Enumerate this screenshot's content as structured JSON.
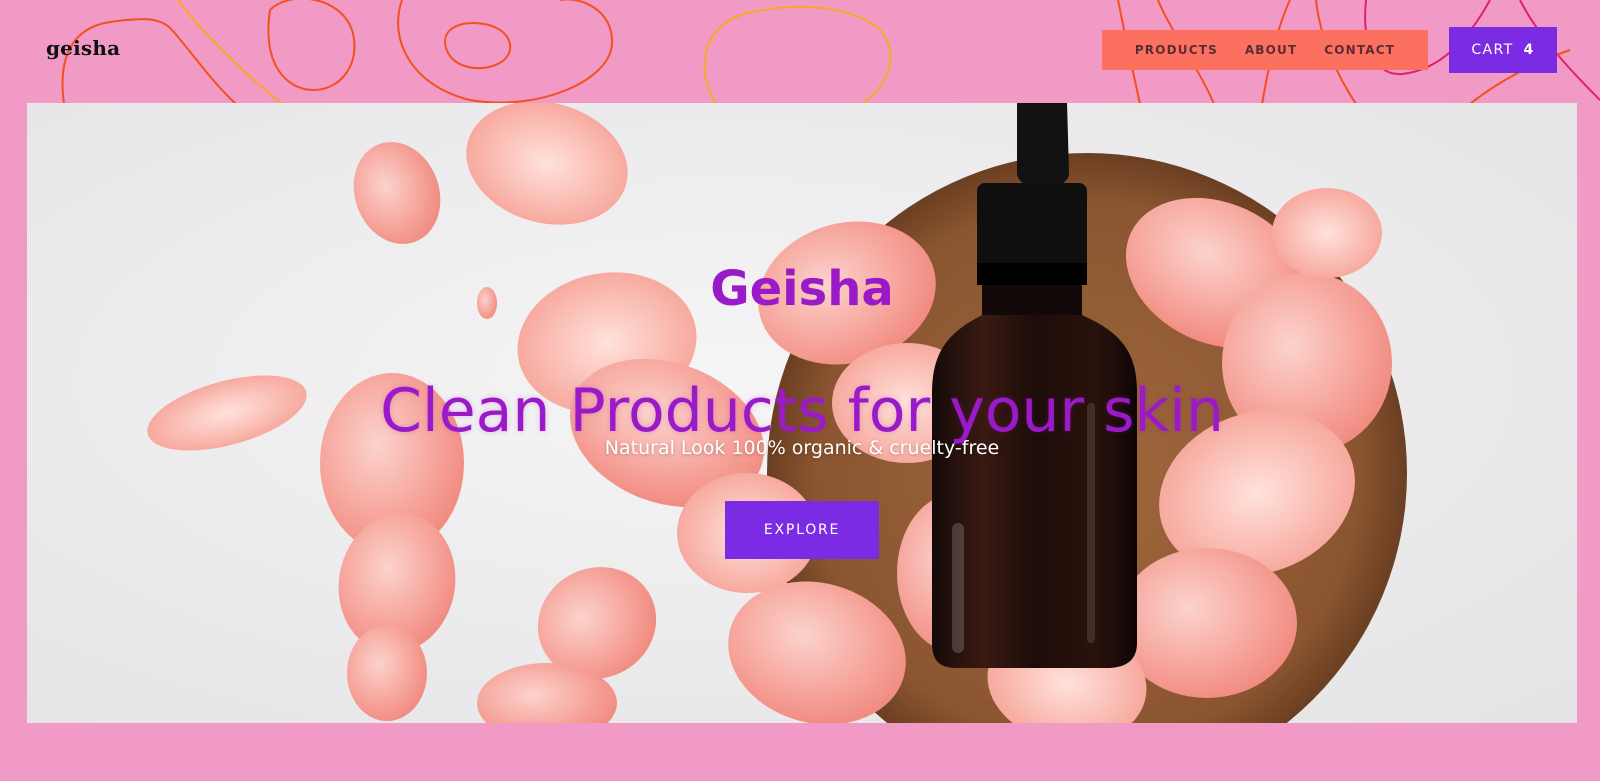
{
  "header": {
    "logo": "geisha",
    "nav": [
      {
        "label": "PRODUCTS"
      },
      {
        "label": "ABOUT"
      },
      {
        "label": "CONTACT"
      }
    ],
    "cart": {
      "label": "CART",
      "count": "4"
    }
  },
  "hero": {
    "brand": "Geisha",
    "heading": "Clean Products for your skin",
    "subheading": "Natural Look 100% organic & cruelty-free",
    "button_label": "EXPLORE"
  },
  "colors": {
    "page_background": "#f09ac5",
    "nav_background": "#fb705f",
    "accent_purple": "#7b2be3",
    "heading_purple": "#9b1ac8",
    "doodle_orange": "#f4501e",
    "doodle_yellow": "#f9a825",
    "doodle_magenta": "#e0206a"
  }
}
